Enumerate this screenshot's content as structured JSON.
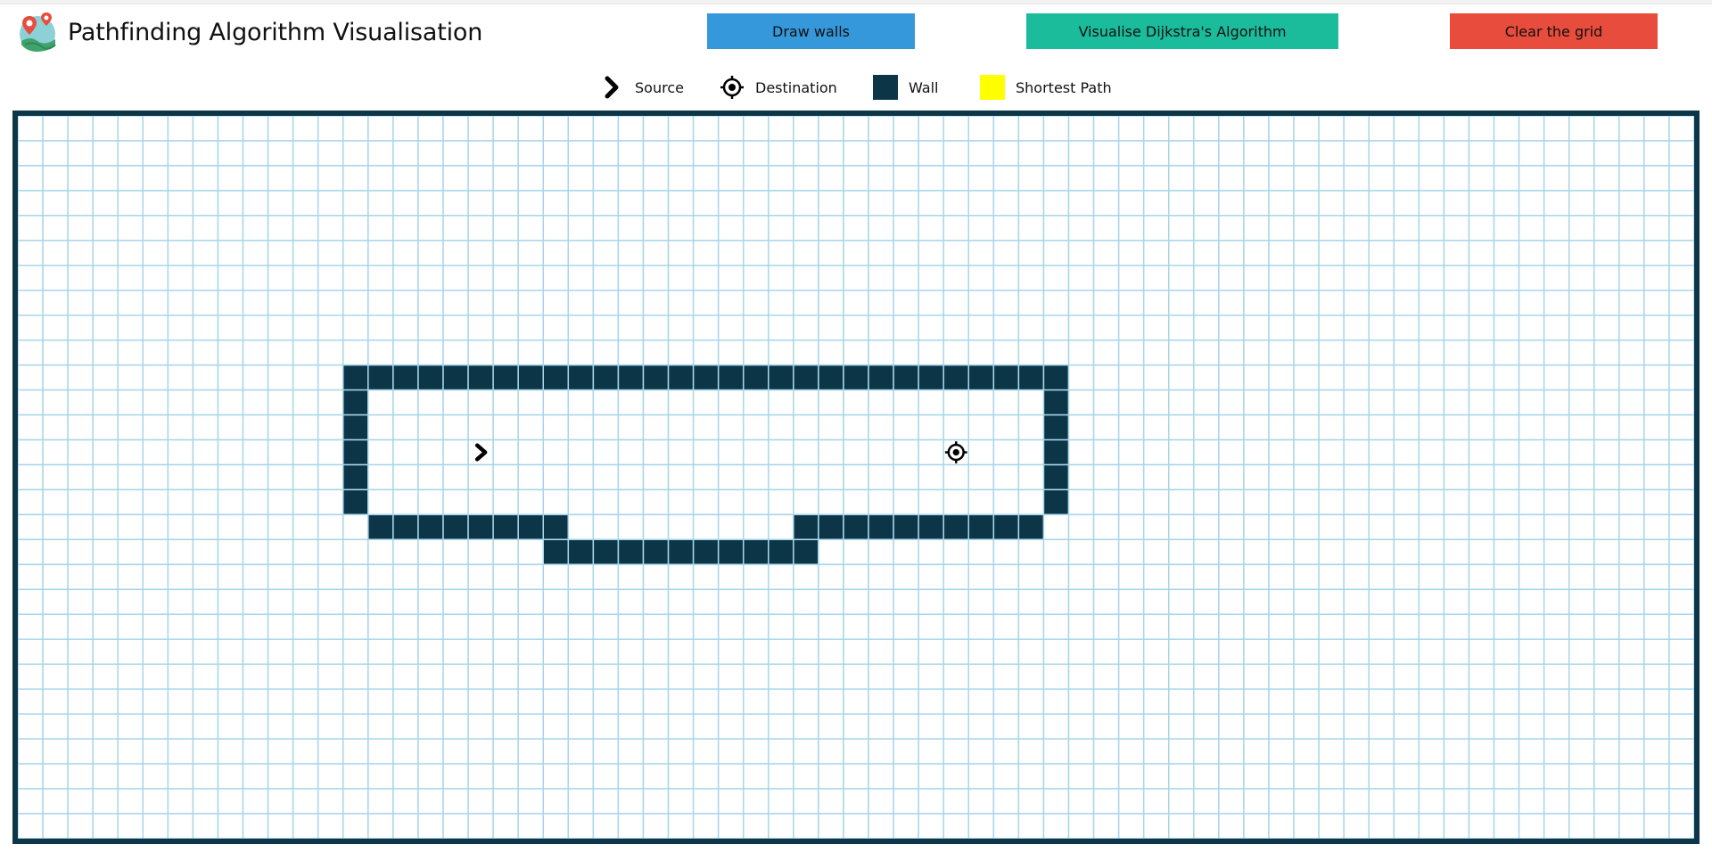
{
  "header": {
    "title": "Pathfinding Algorithm Visualisation",
    "logo": "map-pin-logo"
  },
  "toolbar": {
    "draw_walls_label": "Draw walls",
    "visualise_label": "Visualise Dijkstra's Algorithm",
    "clear_label": "Clear the grid"
  },
  "legend": {
    "source": {
      "label": "Source",
      "icon": "chevron-right-icon"
    },
    "destination": {
      "label": "Destination",
      "icon": "target-icon"
    },
    "wall": {
      "label": "Wall",
      "color": "#0c3547"
    },
    "shortest_path": {
      "label": "Shortest Path",
      "color": "#ffff00"
    }
  },
  "colors": {
    "draw_walls_button": "#3498db",
    "visualise_button": "#1abc9c",
    "clear_button": "#e74c3c",
    "grid_line": "#a9d6ea",
    "wall": "#0c3547",
    "frame": "#0c3547"
  },
  "grid": {
    "cols": 67,
    "rows": 29,
    "source": {
      "row": 13,
      "col": 18
    },
    "destination": {
      "row": 13,
      "col": 37
    },
    "walls": [
      [
        10,
        13
      ],
      [
        10,
        14
      ],
      [
        10,
        15
      ],
      [
        10,
        16
      ],
      [
        10,
        17
      ],
      [
        10,
        18
      ],
      [
        10,
        19
      ],
      [
        10,
        20
      ],
      [
        10,
        21
      ],
      [
        10,
        22
      ],
      [
        10,
        23
      ],
      [
        10,
        24
      ],
      [
        10,
        25
      ],
      [
        10,
        26
      ],
      [
        10,
        27
      ],
      [
        10,
        28
      ],
      [
        10,
        29
      ],
      [
        10,
        30
      ],
      [
        10,
        31
      ],
      [
        10,
        32
      ],
      [
        10,
        33
      ],
      [
        10,
        34
      ],
      [
        10,
        35
      ],
      [
        10,
        36
      ],
      [
        10,
        37
      ],
      [
        10,
        38
      ],
      [
        10,
        39
      ],
      [
        10,
        40
      ],
      [
        10,
        41
      ],
      [
        11,
        13
      ],
      [
        12,
        13
      ],
      [
        13,
        13
      ],
      [
        14,
        13
      ],
      [
        15,
        13
      ],
      [
        11,
        41
      ],
      [
        12,
        41
      ],
      [
        13,
        41
      ],
      [
        14,
        41
      ],
      [
        15,
        41
      ],
      [
        16,
        14
      ],
      [
        16,
        15
      ],
      [
        16,
        16
      ],
      [
        16,
        17
      ],
      [
        16,
        18
      ],
      [
        16,
        19
      ],
      [
        16,
        20
      ],
      [
        16,
        21
      ],
      [
        17,
        21
      ],
      [
        17,
        22
      ],
      [
        17,
        23
      ],
      [
        17,
        24
      ],
      [
        17,
        25
      ],
      [
        17,
        26
      ],
      [
        17,
        27
      ],
      [
        17,
        28
      ],
      [
        17,
        29
      ],
      [
        17,
        30
      ],
      [
        17,
        31
      ],
      [
        16,
        31
      ],
      [
        16,
        32
      ],
      [
        16,
        33
      ],
      [
        16,
        34
      ],
      [
        16,
        35
      ],
      [
        16,
        36
      ],
      [
        16,
        37
      ],
      [
        16,
        38
      ],
      [
        16,
        39
      ],
      [
        16,
        40
      ]
    ]
  }
}
